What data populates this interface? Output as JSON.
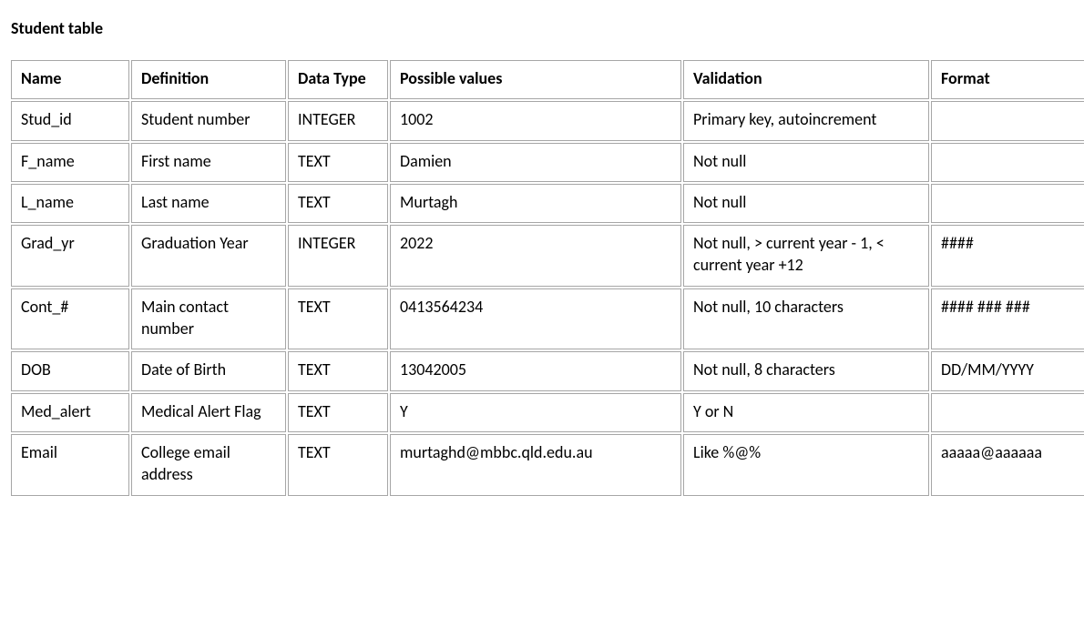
{
  "title": "Student table",
  "columns": [
    "Name",
    "Definition",
    "Data Type",
    "Possible values",
    "Validation",
    "Format"
  ],
  "rows": [
    {
      "name": "Stud_id",
      "definition": "Student number",
      "datatype": "INTEGER",
      "possible": "1002",
      "validation": "Primary key, autoincrement",
      "format": ""
    },
    {
      "name": "F_name",
      "definition": "First name",
      "datatype": "TEXT",
      "possible": "Damien",
      "validation": "Not null",
      "format": ""
    },
    {
      "name": "L_name",
      "definition": "Last name",
      "datatype": "TEXT",
      "possible": "Murtagh",
      "validation": "Not null",
      "format": ""
    },
    {
      "name": "Grad_yr",
      "definition": "Graduation Year",
      "datatype": "INTEGER",
      "possible": "2022",
      "validation": "Not null, > current year - 1, < current year +12",
      "format": "####"
    },
    {
      "name": "Cont_#",
      "definition": "Main contact number",
      "datatype": "TEXT",
      "possible": "0413564234",
      "validation": "Not null, 10 characters",
      "format": "#### ### ###"
    },
    {
      "name": "DOB",
      "definition": "Date of Birth",
      "datatype": "TEXT",
      "possible": "13042005",
      "validation": "Not null, 8 characters",
      "format": "DD/MM/YYYY"
    },
    {
      "name": "Med_alert",
      "definition": "Medical Alert Flag",
      "datatype": "TEXT",
      "possible": "Y",
      "validation": "Y or N",
      "format": ""
    },
    {
      "name": "Email",
      "definition": "College email address",
      "datatype": "TEXT",
      "possible": "murtaghd@mbbc.qld.edu.au",
      "validation": "Like %@%",
      "format": "aaaaa@aaaaaa"
    }
  ]
}
